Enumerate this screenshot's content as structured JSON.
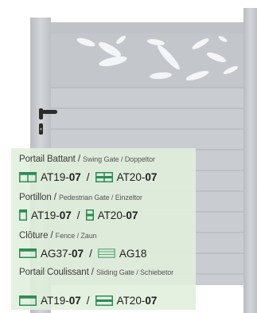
{
  "colors": {
    "gate": "#c7cacf",
    "gate_dark": "#b5b8be",
    "line": "#a9adb4",
    "card_bg": "#e0efdc",
    "icon_green": "#2e8b57",
    "text": "#1e1e1e"
  },
  "rows": [
    {
      "title": "Portail Battant /",
      "subtitle": "Swing Gate / Doppeltor",
      "codes": [
        {
          "icon": "double-swing-gate-icon",
          "prefix": "AT19-",
          "bold": "07"
        },
        {
          "icon": "double-swing-gate-alt-icon",
          "prefix": "AT20-",
          "bold": "07"
        }
      ],
      "separator": "/"
    },
    {
      "title": "Portillon /",
      "subtitle": "Pedestrian Gate / Einzeltor",
      "codes": [
        {
          "icon": "pedestrian-gate-icon",
          "prefix": "AT19-",
          "bold": "07"
        },
        {
          "icon": "pedestrian-gate-alt-icon",
          "prefix": "AT20-",
          "bold": "07"
        }
      ],
      "separator": "/"
    },
    {
      "title": "Clôture /",
      "subtitle": "Fence / Zaun",
      "codes": [
        {
          "icon": "fence-panel-icon",
          "prefix": "AG37-",
          "bold": "07"
        },
        {
          "icon": "fence-panel-outline-icon",
          "prefix": "AG18",
          "bold": ""
        }
      ],
      "separator": "/"
    },
    {
      "title": "Portail Coulissant /",
      "subtitle": "Sliding Gate / Schiebetor",
      "codes": [
        {
          "icon": "sliding-gate-icon",
          "prefix": "AT19-",
          "bold": "07"
        },
        {
          "icon": "sliding-gate-alt-icon",
          "prefix": "AT20-",
          "bold": "07"
        }
      ],
      "separator": "/"
    }
  ]
}
